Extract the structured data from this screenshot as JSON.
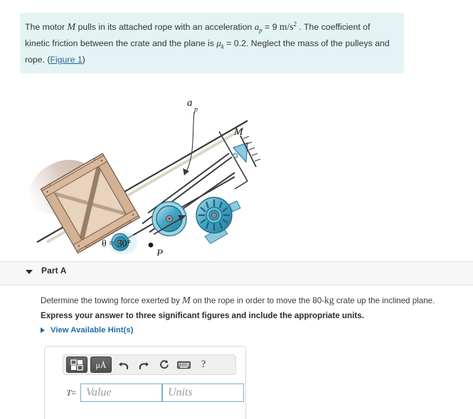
{
  "problem": {
    "text_part1": "The motor ",
    "var_motor": "M",
    "text_part2": " pulls in its attached rope with an acceleration ",
    "var_accel": "a",
    "var_accel_sub": "p",
    "text_eq": " = 9 ",
    "unit_accel": "m/s",
    "unit_accel_sup": "2",
    "text_part3": " . The coefficient of kinetic friction between the crate and the plane is ",
    "var_mu": "μ",
    "var_mu_sub": "k",
    "text_mu_val": " = 0.2. Neglect the mass of the pulleys and rope. (",
    "figure_link": "Figure 1",
    "text_close": ")",
    "background_color": "#e4f4f4"
  },
  "figure": {
    "label_accel": "a",
    "label_accel_sub": "p",
    "label_motor": "M",
    "label_point": "P",
    "label_angle": "θ = 30°",
    "colors": {
      "pulley_blue": "#3fa3c4",
      "pulley_light": "#9fd3e4",
      "crate_tan": "#d8b89e",
      "incline_line": "#3a3a3a",
      "support_blue": "#8fc9e0"
    }
  },
  "part_a": {
    "title": "Part A",
    "caret": "chevron-down-icon",
    "band_color": "#f7f7f7"
  },
  "question": {
    "prompt_part1": "Determine the towing force exerted by ",
    "prompt_var": "M",
    "prompt_part2": " on the rope in order to move the 80-",
    "prompt_unit": "kg",
    "prompt_part3": " crate up the inclined plane.",
    "instruction": "Express your answer to three significant figures and include the appropriate units."
  },
  "hints": {
    "label": "View Available Hint(s)",
    "caret": "chevron-right-icon",
    "link_color": "#1a6ea8"
  },
  "answer": {
    "symbol": "T",
    "equals": "=",
    "value": "",
    "value_placeholder": "Value",
    "units": "",
    "units_placeholder": "Units",
    "toolbar": {
      "template_button": "template-icon",
      "units_button_label": "μÅ",
      "undo_icon": "↶",
      "redo_icon": "↷",
      "reset_icon": "↻",
      "keyboard_icon": "keyboard-icon",
      "help_icon": "?"
    }
  }
}
